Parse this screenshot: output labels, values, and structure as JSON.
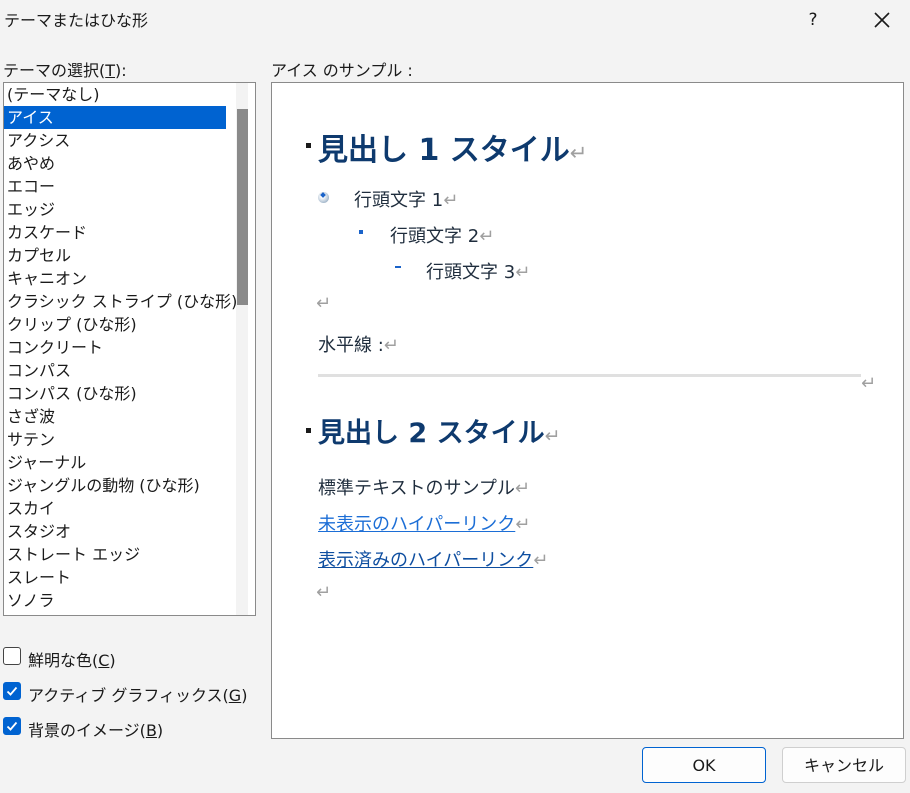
{
  "dialog": {
    "title": "テーマまたはひな形",
    "help_label": "?",
    "ok_label": "OK",
    "cancel_label": "キャンセル"
  },
  "theme_select": {
    "label_pre": "テーマの選択(",
    "label_key": "T",
    "label_post": "):",
    "selected": "アイス",
    "items": [
      "(テーマなし)",
      "アイス",
      "アクシス",
      "あやめ",
      "エコー",
      "エッジ",
      "カスケード",
      "カプセル",
      "キャニオン",
      "クラシック ストライプ (ひな形)",
      "クリップ (ひな形)",
      "コンクリート",
      "コンパス",
      "コンパス (ひな形)",
      "さざ波",
      "サテン",
      "ジャーナル",
      "ジャングルの動物 (ひな形)",
      "スカイ",
      "スタジオ",
      "ストレート エッジ",
      "スレート",
      "ソノラ"
    ]
  },
  "options": [
    {
      "pre": "鮮明な色(",
      "key": "C",
      "post": ")",
      "checked": false
    },
    {
      "pre": "アクティブ グラフィックス(",
      "key": "G",
      "post": ")",
      "checked": true
    },
    {
      "pre": "背景のイメージ(",
      "key": "B",
      "post": ")",
      "checked": true
    }
  ],
  "sample": {
    "label": "アイス のサンプル :",
    "heading1": "見出し 1 スタイル",
    "bullet1": "行頭文字 1",
    "bullet2": "行頭文字 2",
    "bullet3": "行頭文字 3",
    "horizontal_line_label": "水平線 :",
    "heading2": "見出し 2 スタイル",
    "normal_text": "標準テキストのサンプル",
    "link_unvisited": "未表示のハイパーリンク",
    "link_visited": "表示済みのハイパーリンク",
    "paragraph_mark": "↵"
  },
  "colors": {
    "accent": "#0063d1",
    "heading": "#0e3a6e",
    "link": "#1c6ed6",
    "visited_link": "#0e4ea0"
  }
}
